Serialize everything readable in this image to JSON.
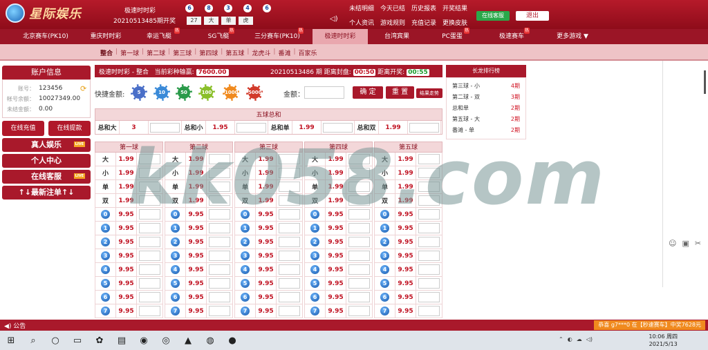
{
  "header": {
    "logo_text": "星际娱乐",
    "lottery_name": "极速时时彩",
    "draw_label": "20210513485期开奖",
    "balls": [
      "6",
      "8",
      "3",
      "4",
      "6"
    ],
    "tags": [
      "27",
      "大",
      "单",
      "虎"
    ],
    "links": [
      "未结明细",
      "今天已结",
      "历史报表",
      "开奖结果",
      "个人资讯",
      "游戏规则",
      "充值记录",
      "更换皮肤"
    ],
    "service_btn": "在线客服",
    "logout_btn": "退出"
  },
  "nav": {
    "items": [
      "北京赛车(PK10)",
      "重庆时时彩",
      "幸运飞艇",
      "SG飞艇",
      "三分赛车(PK10)",
      "极速时时彩",
      "台湾宾果",
      "PC蛋蛋",
      "极速赛车",
      "更多游戏 ▼"
    ],
    "hot": "热"
  },
  "subnav": {
    "items": [
      "整合",
      "第一球",
      "第二球",
      "第三球",
      "第四球",
      "第五球",
      "龙虎斗",
      "番滩",
      "百家乐"
    ]
  },
  "account": {
    "title": "账户信息",
    "rows": [
      {
        "k": "账号：",
        "v": "123456"
      },
      {
        "k": "帐号余额：",
        "v": "10027349.00"
      },
      {
        "k": "未结金额：",
        "v": "0.00"
      }
    ],
    "recharge": "在线充值",
    "withdraw": "在线提款",
    "real": "真人娱乐",
    "center": "个人中心",
    "service": "在线客服",
    "recent": "↑↓最新注单↑↓",
    "badge": "LIVE"
  },
  "main": {
    "title": "极速时时彩 - 整合",
    "win_label": "当前彩种输赢:",
    "win_value": "7600.00",
    "period_text": "20210513486 期 距离封盘:",
    "close_time": "00:50",
    "open_label": "距离开奖:",
    "open_time": "00:55"
  },
  "quick": {
    "label": "快捷金额:",
    "chips": [
      "5",
      "10",
      "50",
      "100",
      "1000",
      "5000"
    ],
    "chip_colors": [
      "#4a6fc8",
      "#3a8ad8",
      "#2a9a4a",
      "#8abf2a",
      "#f08a1e",
      "#d23a2a"
    ],
    "amount_label": "金额：",
    "confirm": "确 定",
    "reset": "重 置",
    "trend": "结果走势"
  },
  "sum": {
    "title": "五球总和",
    "cells": [
      {
        "l": "总和大",
        "o": "3"
      },
      {
        "l": "总和小",
        "o": "1.95"
      },
      {
        "l": "总和单",
        "o": "1.99"
      },
      {
        "l": "总和双",
        "o": "1.99"
      }
    ]
  },
  "balls_grid": {
    "headers": [
      "第一球",
      "第二球",
      "第三球",
      "第四球",
      "第五球"
    ],
    "bets": [
      {
        "l": "大",
        "o": "1.99"
      },
      {
        "l": "小",
        "o": "1.99"
      },
      {
        "l": "单",
        "o": "1.99"
      },
      {
        "l": "双",
        "o": "1.99"
      }
    ],
    "numbers": [
      "0",
      "1",
      "2",
      "3",
      "4",
      "5",
      "6",
      "7"
    ],
    "number_odds": "9.95"
  },
  "dragon": {
    "title": "长龙排行榜",
    "rows": [
      {
        "n": "第三球 - 小",
        "p": "4期"
      },
      {
        "n": "第二球 - 双",
        "p": "3期"
      },
      {
        "n": "总和单",
        "p": "2期"
      },
      {
        "n": "第五球 - 大",
        "p": "2期"
      },
      {
        "n": "番滩 - 单",
        "p": "2期"
      }
    ]
  },
  "watermark": "kk058.com",
  "footer": {
    "notice": "◀) 公告",
    "ticker": "恭喜 g7***0 在【秒速赛车】中奖7628元"
  },
  "taskbar": {
    "time": "10:06 周四",
    "date": "2021/5/13"
  }
}
